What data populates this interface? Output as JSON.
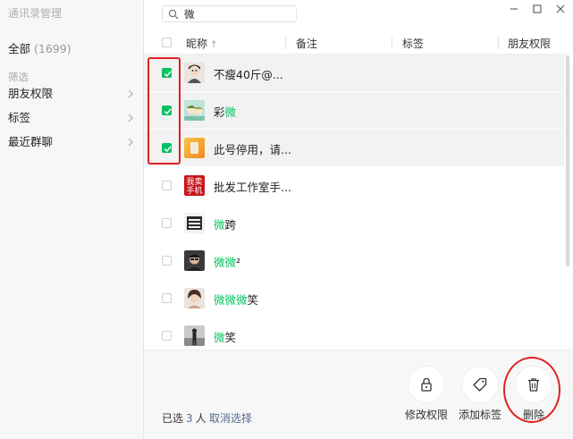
{
  "sidebar": {
    "title": "通讯录管理",
    "all_label": "全部",
    "all_count": "(1699)",
    "filter_label": "筛选",
    "items": [
      {
        "label": "朋友权限"
      },
      {
        "label": "标签"
      },
      {
        "label": "最近群聊"
      }
    ]
  },
  "search": {
    "value": "微"
  },
  "table": {
    "headers": [
      "昵称",
      "备注",
      "标签",
      "朋友权限"
    ],
    "sort_indicator": "↑",
    "rows": [
      {
        "pre": "不瘦40斤@...",
        "hl": "",
        "post": "",
        "checked": true
      },
      {
        "pre": "彩",
        "hl": "微",
        "post": "",
        "checked": true
      },
      {
        "pre": "此号停用，请...",
        "hl": "",
        "post": "",
        "checked": true
      },
      {
        "pre": "批发工作室手...",
        "hl": "",
        "post": "",
        "checked": false
      },
      {
        "pre": "",
        "hl": "微",
        "post": "跨",
        "checked": false
      },
      {
        "pre": "",
        "hl": "微微",
        "post": "²",
        "checked": false
      },
      {
        "pre": "",
        "hl": "微微微",
        "post": "笑",
        "checked": false
      },
      {
        "pre": "",
        "hl": "微",
        "post": "笑",
        "checked": false
      }
    ]
  },
  "avatar_texts": {
    "row4": [
      "我卖",
      "手机"
    ]
  },
  "footer": {
    "selected_prefix": "已选",
    "selected_count": "3",
    "selected_suffix": "人",
    "cancel_label": "取消选择",
    "actions": [
      {
        "label": "修改权限",
        "icon": "lock-icon"
      },
      {
        "label": "添加标签",
        "icon": "tag-icon"
      },
      {
        "label": "删除",
        "icon": "trash-icon"
      }
    ]
  },
  "colors": {
    "accent": "#07c160",
    "link": "#576b95",
    "annotation": "#e02020"
  }
}
